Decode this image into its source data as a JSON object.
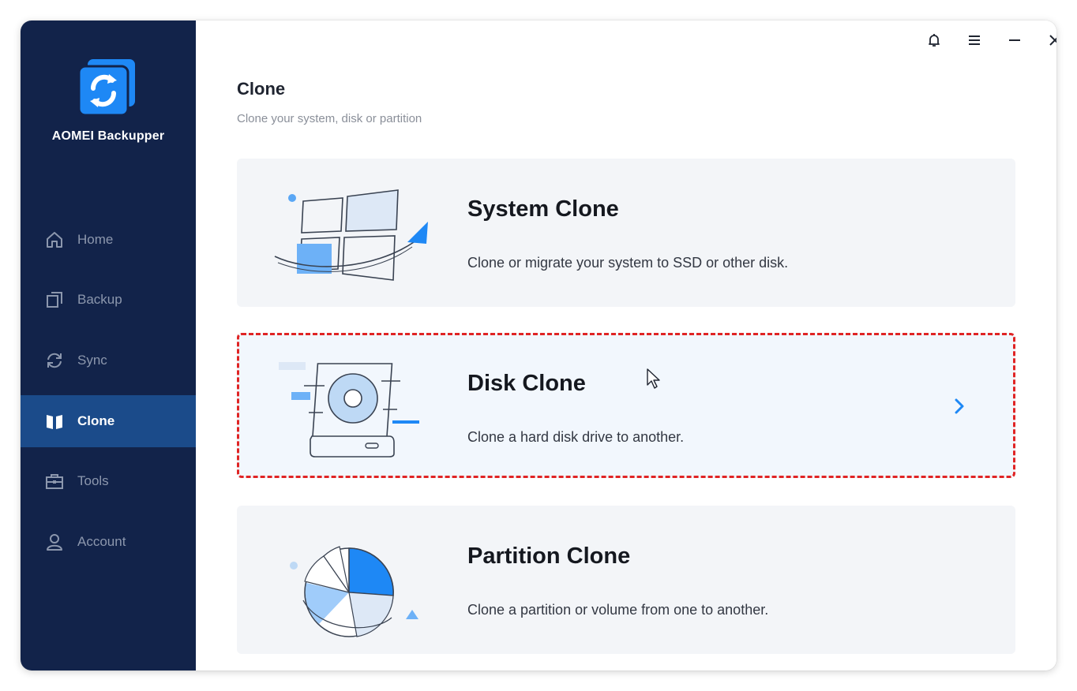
{
  "app": {
    "name": "AOMEI Backupper"
  },
  "sidebar": {
    "items": [
      {
        "label": "Home",
        "icon": "home-icon"
      },
      {
        "label": "Backup",
        "icon": "backup-icon"
      },
      {
        "label": "Sync",
        "icon": "sync-icon"
      },
      {
        "label": "Clone",
        "icon": "clone-icon",
        "active": true
      },
      {
        "label": "Tools",
        "icon": "tools-icon"
      },
      {
        "label": "Account",
        "icon": "account-icon"
      }
    ]
  },
  "titlebar": {
    "icons": [
      "bell-icon",
      "menu-icon",
      "minimize-icon",
      "close-icon"
    ]
  },
  "page": {
    "title": "Clone",
    "subtitle": "Clone your system, disk or partition"
  },
  "cards": [
    {
      "title": "System Clone",
      "description": "Clone or migrate your system to SSD or other disk.",
      "icon": "windows-clone-icon"
    },
    {
      "title": "Disk Clone",
      "description": "Clone a hard disk drive to another.",
      "icon": "disk-icon",
      "selected": true
    },
    {
      "title": "Partition Clone",
      "description": "Clone a partition or volume from one to another.",
      "icon": "partition-pie-icon"
    }
  ],
  "colors": {
    "sidebar_bg": "#12234a",
    "sidebar_active": "#1b4b8a",
    "accent": "#1e88f5",
    "selection_outline": "#e02424"
  }
}
